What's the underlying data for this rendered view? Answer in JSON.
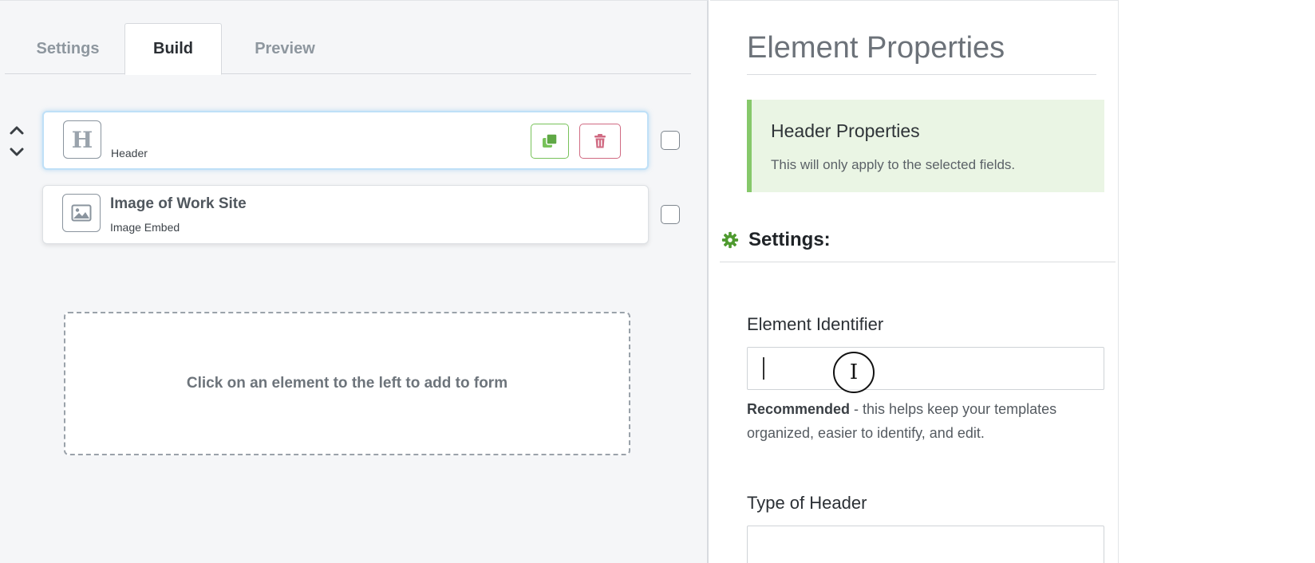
{
  "tabs": [
    {
      "label": "Settings",
      "active": false
    },
    {
      "label": "Build",
      "active": true
    },
    {
      "label": "Preview",
      "active": false
    }
  ],
  "form_elements": [
    {
      "title": "",
      "type": "Header",
      "icon": "header-icon",
      "selected": true,
      "icon_glyph": "H"
    },
    {
      "title": "Image of Work Site",
      "type": "Image Embed",
      "icon": "image-icon",
      "selected": false
    }
  ],
  "dropzone": {
    "text": "Click on an element to the left to add to form"
  },
  "properties": {
    "title": "Element Properties",
    "info_box": {
      "heading": "Header Properties",
      "text": "This will only apply to the selected fields."
    },
    "settings_label": "Settings:",
    "identifier": {
      "label": "Element Identifier",
      "value": "",
      "help_bold": "Recommended",
      "help_text": " - this helps keep your templates organized, easier to identify, and edit."
    },
    "type_of_header": {
      "label": "Type of Header",
      "value": ""
    }
  },
  "colors": {
    "accent_green": "#86c86a",
    "duplicate_green": "#78c25a",
    "delete_red": "#d06a82",
    "info_bg": "#eaf5e4",
    "selected_border": "#bfe0f7"
  }
}
